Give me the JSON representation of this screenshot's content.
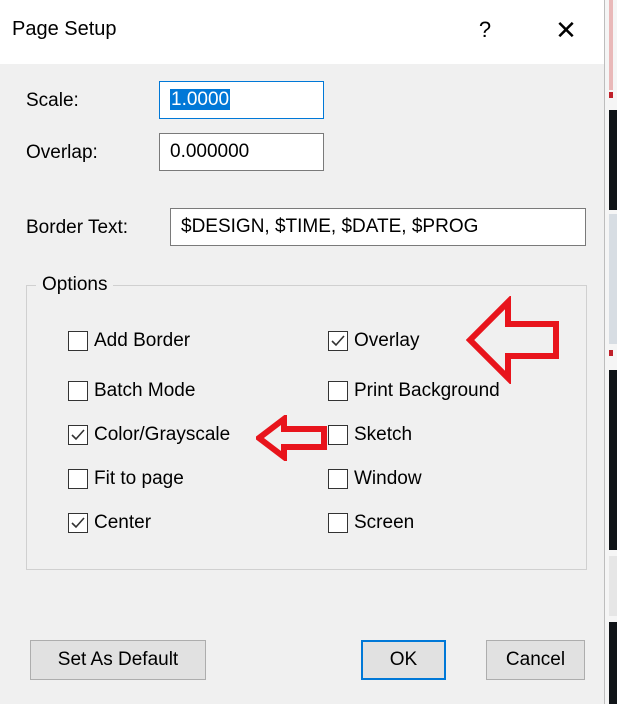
{
  "dialog": {
    "title": "Page Setup",
    "help_label": "?",
    "close_label": "✕"
  },
  "scale": {
    "label": "Scale:",
    "value": "1.0000"
  },
  "overlap": {
    "label": "Overlap:",
    "value": "0.000000"
  },
  "border_text": {
    "label": "Border Text:",
    "value": "$DESIGN, $TIME, $DATE, $PROG"
  },
  "options": {
    "legend": "Options",
    "left": [
      {
        "label": "Add Border",
        "checked": false
      },
      {
        "label": "Batch Mode",
        "checked": false
      },
      {
        "label": "Color/Grayscale",
        "checked": true
      },
      {
        "label": "Fit to page",
        "checked": false
      },
      {
        "label": "Center",
        "checked": true
      }
    ],
    "right": [
      {
        "label": "Overlay",
        "checked": true
      },
      {
        "label": "Print Background",
        "checked": false
      },
      {
        "label": "Sketch",
        "checked": false
      },
      {
        "label": "Window",
        "checked": false
      },
      {
        "label": "Screen",
        "checked": false
      }
    ]
  },
  "buttons": {
    "set_default": "Set As Default",
    "ok": "OK",
    "cancel": "Cancel"
  },
  "colors": {
    "accent": "#0078d7",
    "annotation_arrow": "#e8141c"
  }
}
